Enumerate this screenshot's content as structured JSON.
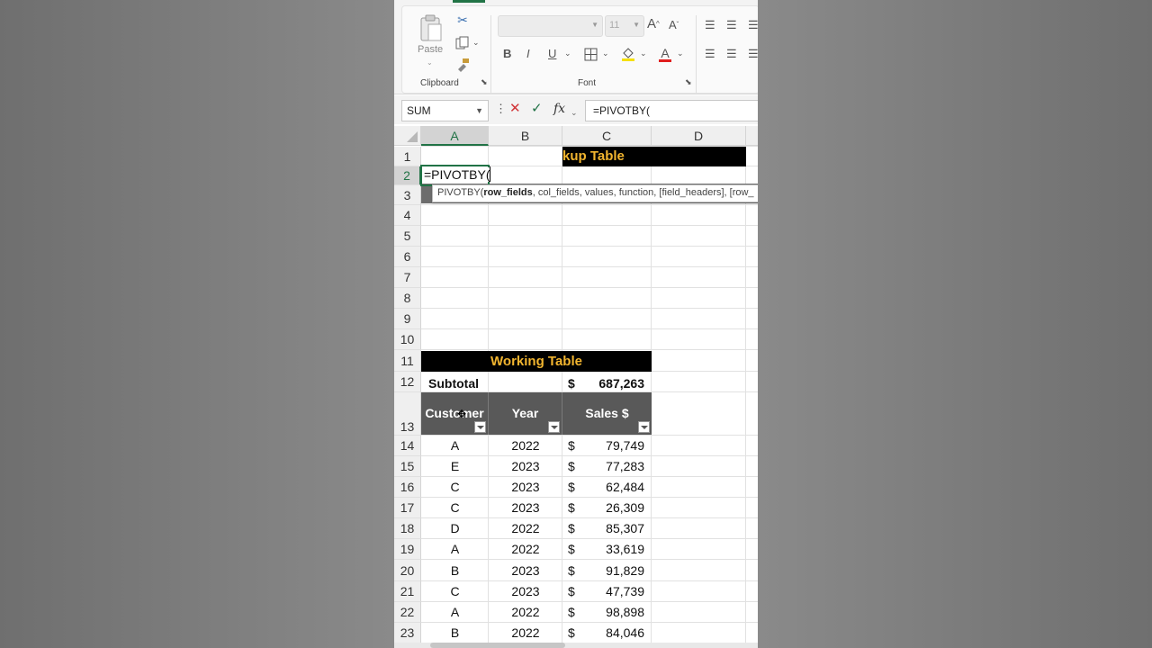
{
  "ribbon": {
    "clipboard": {
      "paste_label": "Paste",
      "group_label": "Clipboard"
    },
    "font": {
      "font_name": "",
      "font_size": "11",
      "bold": "B",
      "italic": "I",
      "underline": "U",
      "font_color": "A",
      "grow": "A",
      "shrink": "A",
      "group_label": "Font"
    }
  },
  "formula_bar": {
    "name_box": "SUM",
    "fx": "fx",
    "formula": "=PIVOTBY("
  },
  "columns": [
    "A",
    "B",
    "C",
    "D"
  ],
  "rows": [
    "1",
    "2",
    "3",
    "4",
    "5",
    "6",
    "7",
    "8",
    "9",
    "10",
    "11",
    "12",
    "13",
    "14",
    "15",
    "16",
    "17",
    "18",
    "19",
    "20",
    "21",
    "22",
    "23"
  ],
  "sheet": {
    "lookup_banner": "kup Table",
    "editing_cell": "=PIVOTBY(",
    "tooltip": {
      "func": "PIVOTBY(",
      "bold_arg": "row_fields",
      "rest": ", col_fields, values, function, [field_headers], [row_"
    },
    "working_banner": "Working Table",
    "subtotal_label": "Subtotal",
    "subtotal_currency": "$",
    "subtotal_value": "687,263",
    "headers": [
      "Customer",
      "Year",
      "Sales $"
    ],
    "records": [
      {
        "customer": "A",
        "year": "2022",
        "cur": "$",
        "sales": "79,749"
      },
      {
        "customer": "E",
        "year": "2023",
        "cur": "$",
        "sales": "77,283"
      },
      {
        "customer": "C",
        "year": "2023",
        "cur": "$",
        "sales": "62,484"
      },
      {
        "customer": "C",
        "year": "2023",
        "cur": "$",
        "sales": "26,309"
      },
      {
        "customer": "D",
        "year": "2022",
        "cur": "$",
        "sales": "85,307"
      },
      {
        "customer": "A",
        "year": "2022",
        "cur": "$",
        "sales": "33,619"
      },
      {
        "customer": "B",
        "year": "2023",
        "cur": "$",
        "sales": "91,829"
      },
      {
        "customer": "C",
        "year": "2023",
        "cur": "$",
        "sales": "47,739"
      },
      {
        "customer": "A",
        "year": "2022",
        "cur": "$",
        "sales": "98,898"
      },
      {
        "customer": "B",
        "year": "2022",
        "cur": "$",
        "sales": "84,046"
      }
    ]
  },
  "colors": {
    "accent": "#217346",
    "banner_text": "#f2b52f",
    "header_fill": "#595959"
  }
}
